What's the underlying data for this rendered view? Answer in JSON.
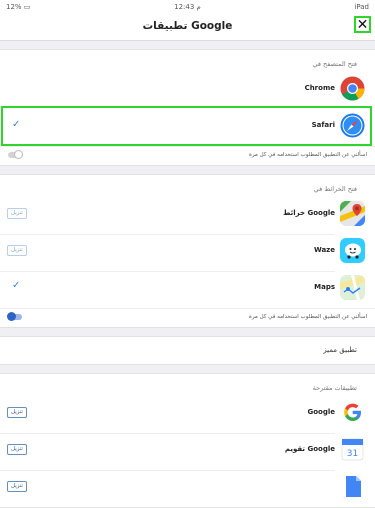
{
  "status_bar": {
    "left": "12% ▭",
    "time": "12:43 م",
    "right": "iPad"
  },
  "nav": {
    "title": "تطبيقات Google",
    "close_glyph": "✕"
  },
  "browser_section": {
    "header": "فتح المتصفح في",
    "apps": [
      {
        "name": "Chrome",
        "icon": "chrome-icon"
      },
      {
        "name": "Safari",
        "icon": "safari-icon",
        "selected": true
      }
    ],
    "ask_label": "اسألني عن التطبيق المطلوب استخدامه في كل مرة",
    "ask_enabled": false
  },
  "maps_section": {
    "header": "فتح الخرائط في",
    "apps": [
      {
        "name": "خرائط Google",
        "icon": "google-maps-icon",
        "action": "تنزيل"
      },
      {
        "name": "Waze",
        "icon": "waze-icon",
        "action": "تنزيل"
      },
      {
        "name": "Maps",
        "icon": "apple-maps-icon",
        "selected": true
      }
    ],
    "ask_label": "اسألني عن التطبيق المطلوب استخدامه في كل مرة",
    "ask_enabled": true
  },
  "preferred": {
    "label": "تطبيق مميز"
  },
  "suggested_section": {
    "header": "تطبيقات مقترحة",
    "apps": [
      {
        "name": "Google",
        "icon": "google-icon",
        "action": "تنزيل"
      },
      {
        "name": "تقويم Google",
        "icon": "google-calendar-icon",
        "action": "تنزيل",
        "icon_text": "31"
      },
      {
        "name": "",
        "icon": "google-docs-icon",
        "action": "تنزيل"
      }
    ]
  },
  "colors": {
    "accent": "#3b7fd9",
    "highlight": "#31d42c",
    "background": "#efeff4"
  }
}
